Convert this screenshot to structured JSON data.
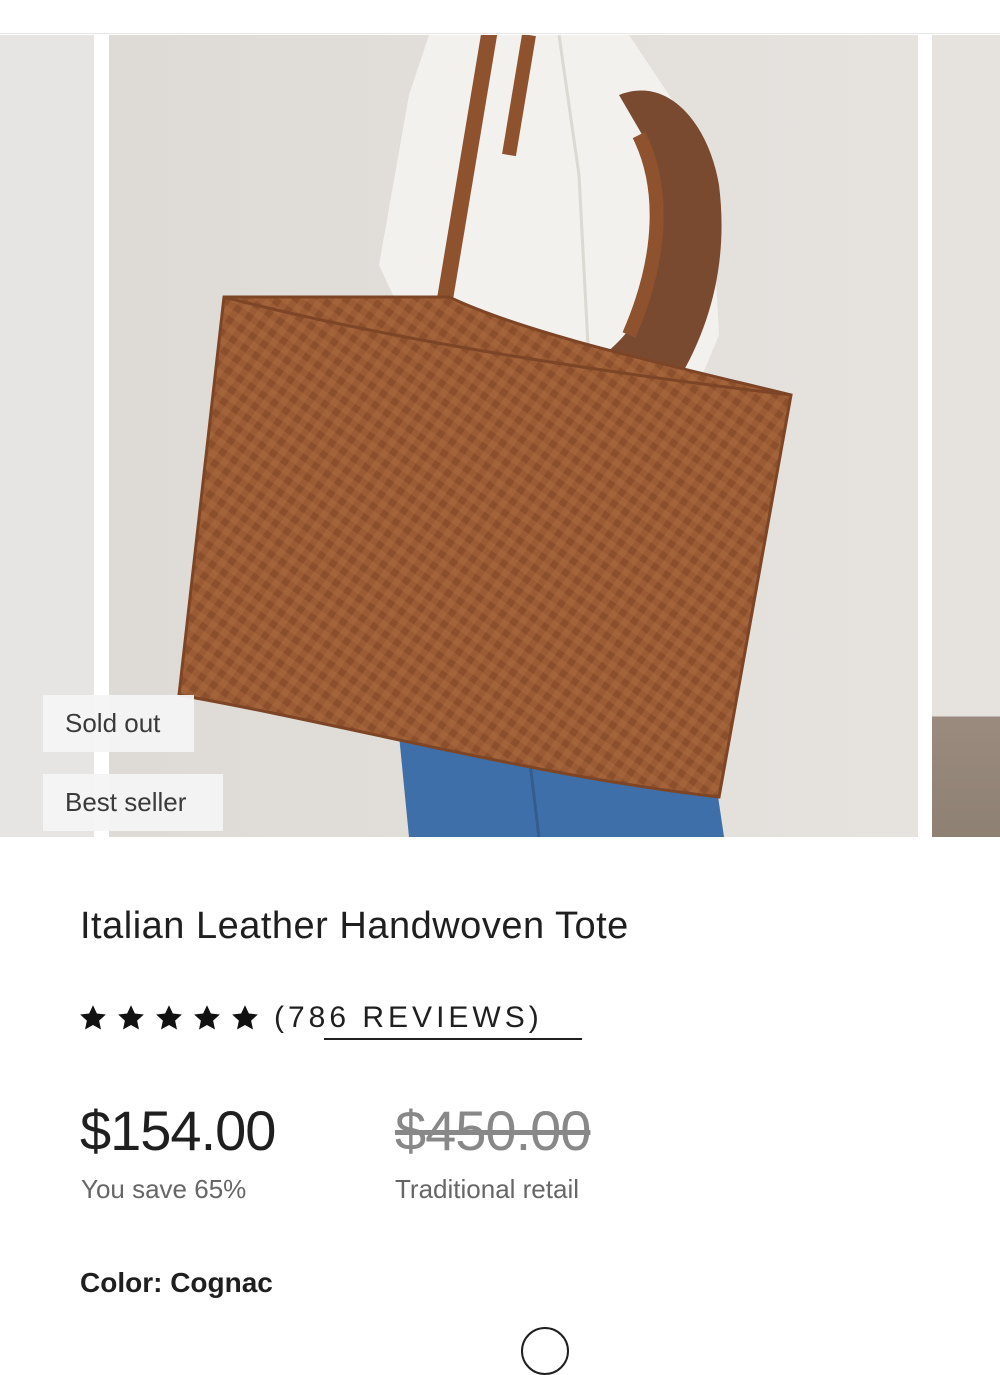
{
  "badges": {
    "sold_out": "Sold out",
    "best_seller": "Best seller"
  },
  "product": {
    "title": "Italian Leather Handwoven Tote",
    "rating_stars": 5,
    "reviews_label": "(786 REVIEWS)",
    "price": "$154.00",
    "savings": "You save 65%",
    "retail_price": "$450.00",
    "retail_label": "Traditional retail",
    "color_label": "Color: Cognac"
  },
  "colors": {
    "leather": "#9a5a34",
    "background": "#e3dfdb",
    "shirt": "#f3f1ee",
    "denim": "#3f6fa8",
    "text": "#1f1f1f"
  }
}
